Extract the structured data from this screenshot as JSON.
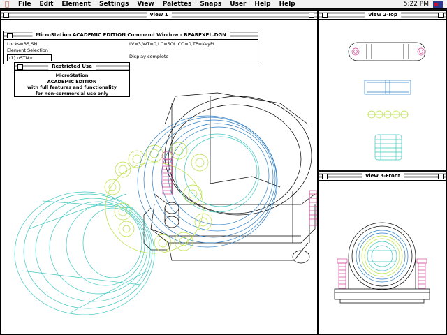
{
  "menubar": {
    "items": [
      "File",
      "Edit",
      "Element",
      "Settings",
      "View",
      "Palettes",
      "Snaps",
      "User",
      "Help",
      "Help"
    ],
    "clock": "5:22 PM"
  },
  "view1": {
    "title": "View 1"
  },
  "view2": {
    "title": "View 2-Top"
  },
  "view3": {
    "title": "View 3-Front"
  },
  "command_window": {
    "title": "MicroStation ACADEMIC EDITION Command Window - BEAREXPL.DGN",
    "locks": "Locks=BS,SN",
    "selection": "Element Selection",
    "prompt": "(1) uSTN>",
    "status": "LV=3,WT=0,LC=SOL,CO=0,TP=KeyPt",
    "message": "Display complete"
  },
  "restricted": {
    "title": "Restricted Use",
    "line1": "MicroStation",
    "line2": "ACADEMIC EDITION",
    "line3": "with full features and functionality",
    "line4": "for non-commercial use only"
  },
  "colors": {
    "cyan": "#3fc8c0",
    "blue": "#2f7fc4",
    "lime": "#b8e03a",
    "pink": "#d64a9a",
    "black": "#000000"
  }
}
